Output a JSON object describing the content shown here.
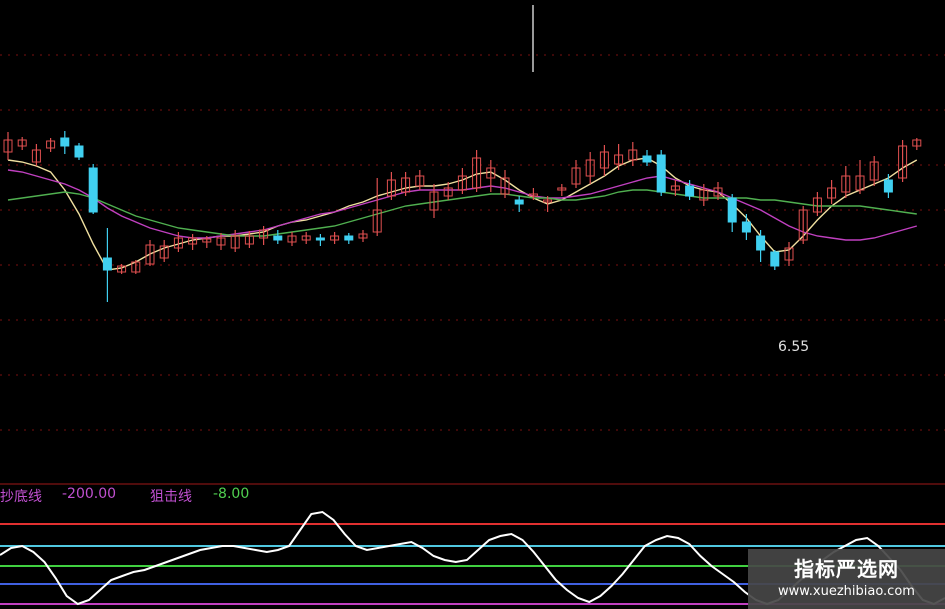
{
  "chart_data": [
    {
      "type": "candlestick",
      "panel": "price",
      "price_label": "6.55",
      "candles": [
        {
          "o": 152,
          "c": 140,
          "h": 132,
          "l": 160
        },
        {
          "o": 146,
          "c": 140,
          "h": 137,
          "l": 150
        },
        {
          "o": 162,
          "c": 150,
          "h": 144,
          "l": 166
        },
        {
          "o": 148,
          "c": 141,
          "h": 138,
          "l": 152
        },
        {
          "o": 138,
          "c": 146,
          "h": 131,
          "l": 154
        },
        {
          "o": 146,
          "c": 157,
          "h": 143,
          "l": 160
        },
        {
          "o": 168,
          "c": 212,
          "h": 164,
          "l": 214
        },
        {
          "o": 258,
          "c": 270,
          "h": 228,
          "l": 302
        },
        {
          "o": 272,
          "c": 266,
          "h": 264,
          "l": 274
        },
        {
          "o": 272,
          "c": 262,
          "h": 260,
          "l": 274
        },
        {
          "o": 264,
          "c": 245,
          "h": 240,
          "l": 266
        },
        {
          "o": 258,
          "c": 246,
          "h": 240,
          "l": 262
        },
        {
          "o": 248,
          "c": 238,
          "h": 232,
          "l": 252
        },
        {
          "o": 244,
          "c": 238,
          "h": 234,
          "l": 250
        },
        {
          "o": 242,
          "c": 239,
          "h": 236,
          "l": 248
        },
        {
          "o": 245,
          "c": 238,
          "h": 233,
          "l": 250
        },
        {
          "o": 248,
          "c": 236,
          "h": 230,
          "l": 252
        },
        {
          "o": 244,
          "c": 236,
          "h": 231,
          "l": 248
        },
        {
          "o": 238,
          "c": 230,
          "h": 226,
          "l": 245
        },
        {
          "o": 236,
          "c": 240,
          "h": 230,
          "l": 244
        },
        {
          "o": 242,
          "c": 236,
          "h": 232,
          "l": 246
        },
        {
          "o": 240,
          "c": 236,
          "h": 232,
          "l": 244
        },
        {
          "o": 238,
          "c": 240,
          "h": 234,
          "l": 246
        },
        {
          "o": 240,
          "c": 236,
          "h": 232,
          "l": 244
        },
        {
          "o": 236,
          "c": 240,
          "h": 233,
          "l": 244
        },
        {
          "o": 238,
          "c": 234,
          "h": 230,
          "l": 242
        },
        {
          "o": 232,
          "c": 210,
          "h": 178,
          "l": 236
        },
        {
          "o": 196,
          "c": 180,
          "h": 172,
          "l": 200
        },
        {
          "o": 192,
          "c": 178,
          "h": 172,
          "l": 196
        },
        {
          "o": 186,
          "c": 176,
          "h": 170,
          "l": 190
        },
        {
          "o": 210,
          "c": 192,
          "h": 184,
          "l": 218
        },
        {
          "o": 196,
          "c": 188,
          "h": 182,
          "l": 200
        },
        {
          "o": 190,
          "c": 176,
          "h": 168,
          "l": 194
        },
        {
          "o": 188,
          "c": 158,
          "h": 150,
          "l": 192
        },
        {
          "o": 178,
          "c": 168,
          "h": 160,
          "l": 192
        },
        {
          "o": 194,
          "c": 178,
          "h": 170,
          "l": 198
        },
        {
          "o": 200,
          "c": 204,
          "h": 196,
          "l": 212
        },
        {
          "o": 196,
          "c": 194,
          "h": 188,
          "l": 200
        },
        {
          "o": 202,
          "c": 200,
          "h": 196,
          "l": 212
        },
        {
          "o": 190,
          "c": 188,
          "h": 184,
          "l": 196
        },
        {
          "o": 184,
          "c": 168,
          "h": 160,
          "l": 188
        },
        {
          "o": 176,
          "c": 160,
          "h": 152,
          "l": 184
        },
        {
          "o": 168,
          "c": 152,
          "h": 145,
          "l": 176
        },
        {
          "o": 164,
          "c": 155,
          "h": 144,
          "l": 170
        },
        {
          "o": 160,
          "c": 150,
          "h": 142,
          "l": 166
        },
        {
          "o": 156,
          "c": 162,
          "h": 150,
          "l": 166
        },
        {
          "o": 155,
          "c": 192,
          "h": 150,
          "l": 196
        },
        {
          "o": 190,
          "c": 186,
          "h": 180,
          "l": 196
        },
        {
          "o": 186,
          "c": 196,
          "h": 180,
          "l": 200
        },
        {
          "o": 200,
          "c": 190,
          "h": 184,
          "l": 206
        },
        {
          "o": 196,
          "c": 188,
          "h": 182,
          "l": 200
        },
        {
          "o": 198,
          "c": 222,
          "h": 194,
          "l": 232
        },
        {
          "o": 222,
          "c": 232,
          "h": 214,
          "l": 240
        },
        {
          "o": 236,
          "c": 250,
          "h": 230,
          "l": 262
        },
        {
          "o": 252,
          "c": 266,
          "h": 250,
          "l": 270
        },
        {
          "o": 260,
          "c": 248,
          "h": 242,
          "l": 266
        },
        {
          "o": 240,
          "c": 210,
          "h": 206,
          "l": 244
        },
        {
          "o": 212,
          "c": 198,
          "h": 192,
          "l": 216
        },
        {
          "o": 198,
          "c": 188,
          "h": 180,
          "l": 204
        },
        {
          "o": 192,
          "c": 176,
          "h": 166,
          "l": 198
        },
        {
          "o": 190,
          "c": 176,
          "h": 160,
          "l": 194
        },
        {
          "o": 180,
          "c": 162,
          "h": 156,
          "l": 186
        },
        {
          "o": 180,
          "c": 192,
          "h": 174,
          "l": 198
        },
        {
          "o": 178,
          "c": 146,
          "h": 140,
          "l": 182
        },
        {
          "o": 146,
          "c": 140,
          "h": 138,
          "l": 150
        }
      ],
      "series": [
        {
          "values": [
            160,
            162,
            166,
            172,
            190,
            214,
            244,
            270,
            268,
            262,
            254,
            248,
            244,
            240,
            238,
            236,
            236,
            234,
            232,
            226,
            222,
            220,
            216,
            212,
            206,
            202,
            196,
            192,
            188,
            186,
            186,
            184,
            180,
            174,
            172,
            180,
            190,
            198,
            204,
            200,
            192,
            184,
            176,
            166,
            160,
            158,
            166,
            178,
            186,
            190,
            192,
            204,
            218,
            236,
            252,
            250,
            236,
            220,
            206,
            196,
            190,
            184,
            178,
            168,
            160
          ]
        },
        {
          "values": [
            170,
            172,
            176,
            180,
            184,
            190,
            198,
            208,
            216,
            222,
            228,
            232,
            236,
            238,
            238,
            236,
            234,
            232,
            230,
            226,
            222,
            218,
            214,
            212,
            208,
            204,
            200,
            196,
            192,
            190,
            190,
            190,
            190,
            188,
            186,
            188,
            192,
            196,
            198,
            198,
            196,
            194,
            190,
            186,
            182,
            178,
            176,
            180,
            184,
            188,
            192,
            198,
            204,
            210,
            218,
            226,
            232,
            236,
            238,
            240,
            240,
            238,
            234,
            230,
            226
          ]
        },
        {
          "values": [
            200,
            198,
            196,
            194,
            192,
            194,
            198,
            204,
            210,
            216,
            220,
            224,
            228,
            230,
            232,
            234,
            236,
            236,
            236,
            234,
            232,
            230,
            228,
            226,
            222,
            218,
            214,
            210,
            206,
            204,
            202,
            200,
            198,
            196,
            194,
            194,
            196,
            198,
            198,
            200,
            200,
            198,
            196,
            192,
            190,
            190,
            192,
            194,
            196,
            198,
            198,
            198,
            198,
            200,
            200,
            202,
            204,
            206,
            206,
            206,
            206,
            208,
            210,
            212,
            214
          ]
        }
      ]
    },
    {
      "type": "line",
      "panel": "indicator",
      "label_1": "抄底线",
      "value_1": "-200.00",
      "label_2": "狙击线",
      "value_2": "-8.00",
      "series": [
        {
          "values": [
            555,
            548,
            546,
            552,
            562,
            578,
            596,
            604,
            600,
            590,
            580,
            576,
            572,
            570,
            566,
            562,
            558,
            554,
            550,
            548,
            546,
            546,
            548,
            550,
            552,
            550,
            546,
            530,
            514,
            512,
            520,
            534,
            546,
            550,
            548,
            546,
            544,
            542,
            548,
            556,
            560,
            562,
            560,
            550,
            540,
            536,
            534,
            540,
            552,
            566,
            580,
            590,
            598,
            602,
            596,
            586,
            574,
            560,
            546,
            540,
            536,
            538,
            544,
            556,
            566,
            574,
            582,
            592,
            600,
            604,
            600,
            590,
            580,
            570,
            560,
            552,
            546,
            540,
            538,
            546,
            558,
            570,
            586,
            600,
            604,
            598
          ]
        }
      ]
    }
  ],
  "watermark": {
    "title": "指标严选网",
    "url": "www.xuezhibiao.com"
  }
}
